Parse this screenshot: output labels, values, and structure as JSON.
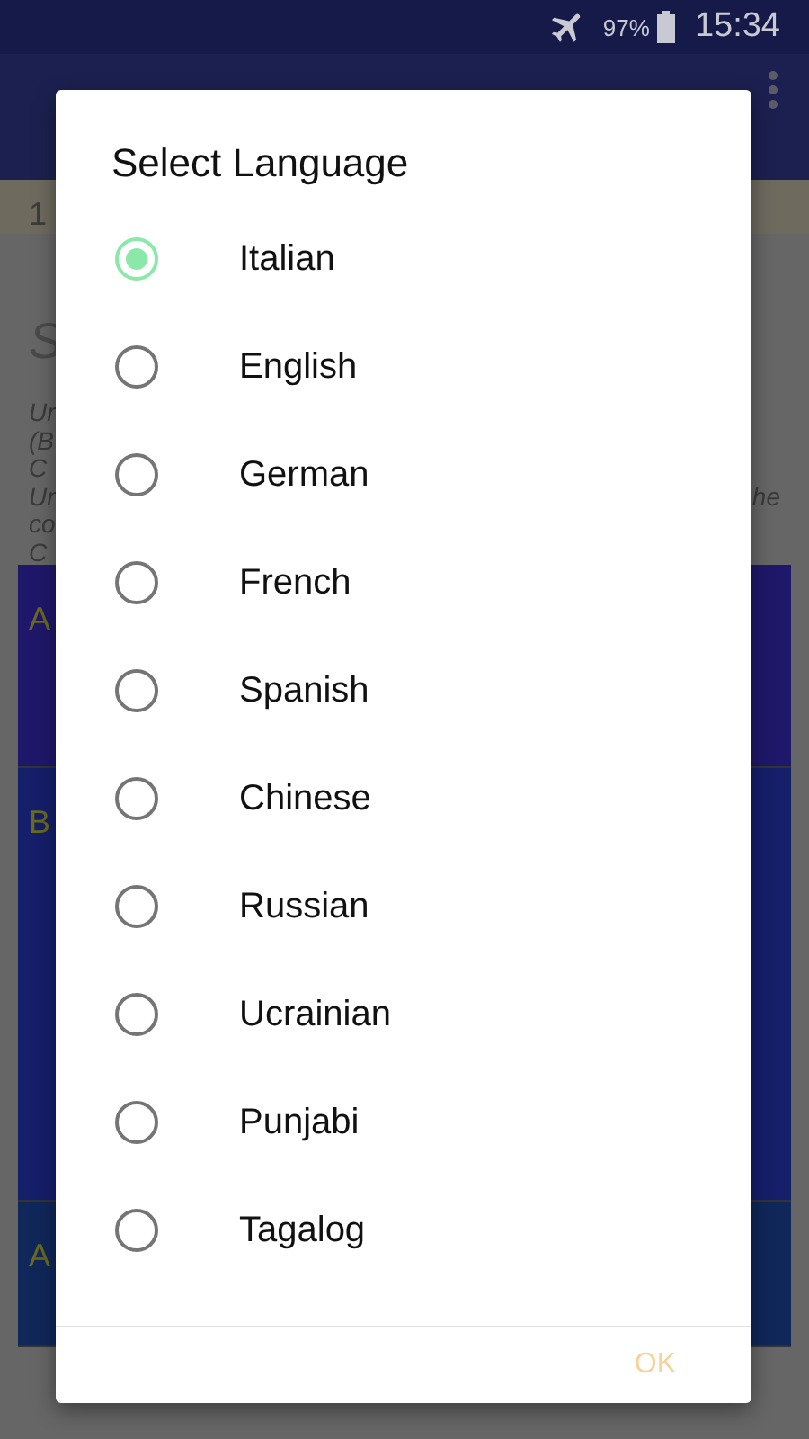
{
  "status_bar": {
    "battery": "97%",
    "time": "15:34"
  },
  "background": {
    "date": "1",
    "subheading": "S",
    "notes": [
      "Ur",
      "(B",
      "C",
      "Ur",
      "co",
      "C"
    ],
    "note_tail": "he",
    "panels": [
      {
        "label": "A"
      },
      {
        "label": "B"
      },
      {
        "label": "A"
      }
    ]
  },
  "dialog": {
    "title": "Select Language",
    "options": [
      {
        "label": "Italian",
        "selected": true
      },
      {
        "label": "English",
        "selected": false
      },
      {
        "label": "German",
        "selected": false
      },
      {
        "label": "French",
        "selected": false
      },
      {
        "label": "Spanish",
        "selected": false
      },
      {
        "label": "Chinese",
        "selected": false
      },
      {
        "label": "Russian",
        "selected": false
      },
      {
        "label": "Ucrainian",
        "selected": false
      },
      {
        "label": "Punjabi",
        "selected": false
      },
      {
        "label": "Tagalog",
        "selected": false
      }
    ],
    "buttons": [
      "OK"
    ]
  }
}
